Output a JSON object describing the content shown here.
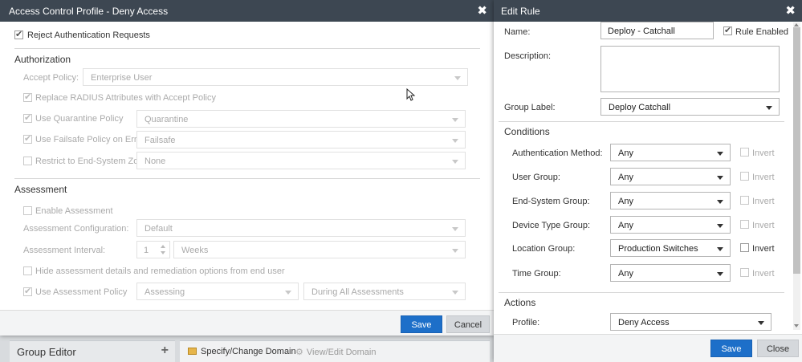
{
  "background": {
    "group_editor_label": "Group Editor",
    "group_editor_plus": "+",
    "toolbar": {
      "specify_domain": "Specify/Change Domain",
      "view_domain": "View/Edit Domain"
    }
  },
  "acp_dialog": {
    "title": "Access Control Profile - Deny Access",
    "close": "✖",
    "reject_auth_label": "Reject Authentication Requests",
    "authorization": {
      "heading": "Authorization",
      "accept_policy_label": "Accept Policy:",
      "accept_policy_value": "Enterprise User",
      "replace_radius_label": "Replace RADIUS Attributes with Accept Policy",
      "quarantine_label": "Use Quarantine Policy",
      "quarantine_value": "Quarantine",
      "failsafe_label": "Use Failsafe Policy on Error",
      "failsafe_value": "Failsafe",
      "restrict_zone_label": "Restrict to End-System Zone",
      "restrict_zone_value": "None"
    },
    "assessment": {
      "heading": "Assessment",
      "enable_label": "Enable Assessment",
      "config_label": "Assessment Configuration:",
      "config_value": "Default",
      "interval_label": "Assessment Interval:",
      "interval_value": "1",
      "interval_unit": "Weeks",
      "hide_details_label": "Hide assessment details and remediation options from end user",
      "policy_label": "Use Assessment Policy",
      "policy_value": "Assessing",
      "policy_when": "During All Assessments"
    },
    "save_label": "Save",
    "cancel_label": "Cancel"
  },
  "edit_rule_dialog": {
    "title": "Edit Rule",
    "close": "✖",
    "name_label": "Name:",
    "name_value": "Deploy - Catchall",
    "rule_enabled_label": "Rule Enabled",
    "description_label": "Description:",
    "description_value": "",
    "group_label_label": "Group Label:",
    "group_label_value": "Deploy Catchall",
    "conditions_heading": "Conditions",
    "invert_label": "Invert",
    "conditions": [
      {
        "label": "Authentication Method:",
        "value": "Any"
      },
      {
        "label": "User Group:",
        "value": "Any"
      },
      {
        "label": "End-System Group:",
        "value": "Any"
      },
      {
        "label": "Device Type Group:",
        "value": "Any"
      },
      {
        "label": "Location Group:",
        "value": "Production Switches"
      },
      {
        "label": "Time Group:",
        "value": "Any"
      }
    ],
    "actions_heading": "Actions",
    "profile_label": "Profile:",
    "profile_value": "Deny Access",
    "save_label": "Save",
    "close_label": "Close"
  },
  "colors": {
    "header": "#3d4752",
    "primary_button": "#1d6fc9"
  }
}
